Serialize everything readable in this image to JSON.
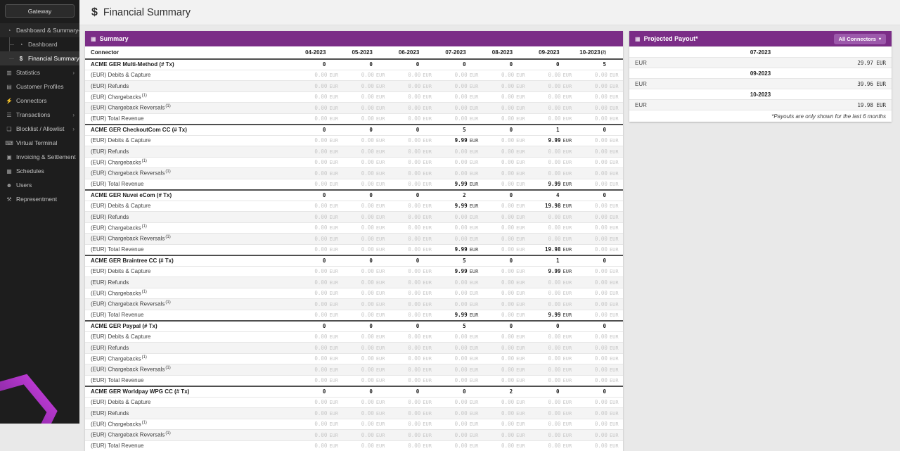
{
  "sidebar": {
    "gateway_label": "Gateway",
    "items": [
      {
        "label": "Dashboard & Summary",
        "icon": "dashboard-icon",
        "chevron": "down",
        "type": "parent"
      },
      {
        "label": "Dashboard",
        "icon": "dashboard-icon",
        "type": "child"
      },
      {
        "label": "Financial Summary",
        "icon": "dollar-icon",
        "type": "child",
        "active": true
      },
      {
        "label": "Statistics",
        "icon": "chart-icon",
        "chevron": "right"
      },
      {
        "label": "Customer Profiles",
        "icon": "profile-icon"
      },
      {
        "label": "Connectors",
        "icon": "plug-icon"
      },
      {
        "label": "Transactions",
        "icon": "list-icon",
        "chevron": "right"
      },
      {
        "label": "Blocklist / Allowlist",
        "icon": "file-icon",
        "chevron": "right"
      },
      {
        "label": "Virtual Terminal",
        "icon": "keyboard-icon"
      },
      {
        "label": "Invoicing & Settlement",
        "icon": "briefcase-icon"
      },
      {
        "label": "Schedules",
        "icon": "calendar-icon"
      },
      {
        "label": "Users",
        "icon": "users-icon"
      },
      {
        "label": "Representment",
        "icon": "wrench-icon"
      }
    ]
  },
  "header": {
    "title": "Financial Summary",
    "icon": "dollar-icon"
  },
  "summary_table": {
    "title": "Summary",
    "icon": "table-icon",
    "first_column_header": "Connector",
    "currency": "EUR",
    "months": [
      {
        "label": "04-2023"
      },
      {
        "label": "05-2023"
      },
      {
        "label": "06-2023"
      },
      {
        "label": "07-2023"
      },
      {
        "label": "08-2023"
      },
      {
        "label": "09-2023"
      },
      {
        "label": "10-2023",
        "sup": "(2)"
      }
    ],
    "groups": [
      {
        "name": "ACME GER Multi-Method (# Tx)",
        "counts": [
          "0",
          "0",
          "0",
          "0",
          "0",
          "0",
          "5"
        ],
        "rows": [
          {
            "label": "(EUR) Debits & Capture",
            "values": [
              "0.00",
              "0.00",
              "0.00",
              "0.00",
              "0.00",
              "0.00",
              "0.00"
            ]
          },
          {
            "label": "(EUR) Refunds",
            "values": [
              "0.00",
              "0.00",
              "0.00",
              "0.00",
              "0.00",
              "0.00",
              "0.00"
            ]
          },
          {
            "label": "(EUR) Chargebacks",
            "sup": "(1)",
            "values": [
              "0.00",
              "0.00",
              "0.00",
              "0.00",
              "0.00",
              "0.00",
              "0.00"
            ]
          },
          {
            "label": "(EUR) Chargeback Reversals",
            "sup": "(1)",
            "values": [
              "0.00",
              "0.00",
              "0.00",
              "0.00",
              "0.00",
              "0.00",
              "0.00"
            ]
          },
          {
            "label": "(EUR) Total Revenue",
            "values": [
              "0.00",
              "0.00",
              "0.00",
              "0.00",
              "0.00",
              "0.00",
              "0.00"
            ]
          }
        ]
      },
      {
        "name": "ACME GER CheckoutCom CC (# Tx)",
        "counts": [
          "0",
          "0",
          "0",
          "5",
          "0",
          "1",
          "0"
        ],
        "rows": [
          {
            "label": "(EUR) Debits & Capture",
            "values": [
              "0.00",
              "0.00",
              "0.00",
              "9.99",
              "0.00",
              "9.99",
              "0.00"
            ]
          },
          {
            "label": "(EUR) Refunds",
            "values": [
              "0.00",
              "0.00",
              "0.00",
              "0.00",
              "0.00",
              "0.00",
              "0.00"
            ]
          },
          {
            "label": "(EUR) Chargebacks",
            "sup": "(1)",
            "values": [
              "0.00",
              "0.00",
              "0.00",
              "0.00",
              "0.00",
              "0.00",
              "0.00"
            ]
          },
          {
            "label": "(EUR) Chargeback Reversals",
            "sup": "(1)",
            "values": [
              "0.00",
              "0.00",
              "0.00",
              "0.00",
              "0.00",
              "0.00",
              "0.00"
            ]
          },
          {
            "label": "(EUR) Total Revenue",
            "values": [
              "0.00",
              "0.00",
              "0.00",
              "9.99",
              "0.00",
              "9.99",
              "0.00"
            ]
          }
        ]
      },
      {
        "name": "ACME GER Nuvei eCom (# Tx)",
        "counts": [
          "0",
          "0",
          "0",
          "2",
          "0",
          "4",
          "0"
        ],
        "rows": [
          {
            "label": "(EUR) Debits & Capture",
            "values": [
              "0.00",
              "0.00",
              "0.00",
              "9.99",
              "0.00",
              "19.98",
              "0.00"
            ]
          },
          {
            "label": "(EUR) Refunds",
            "values": [
              "0.00",
              "0.00",
              "0.00",
              "0.00",
              "0.00",
              "0.00",
              "0.00"
            ]
          },
          {
            "label": "(EUR) Chargebacks",
            "sup": "(1)",
            "values": [
              "0.00",
              "0.00",
              "0.00",
              "0.00",
              "0.00",
              "0.00",
              "0.00"
            ]
          },
          {
            "label": "(EUR) Chargeback Reversals",
            "sup": "(1)",
            "values": [
              "0.00",
              "0.00",
              "0.00",
              "0.00",
              "0.00",
              "0.00",
              "0.00"
            ]
          },
          {
            "label": "(EUR) Total Revenue",
            "values": [
              "0.00",
              "0.00",
              "0.00",
              "9.99",
              "0.00",
              "19.98",
              "0.00"
            ]
          }
        ]
      },
      {
        "name": "ACME GER Braintree CC (# Tx)",
        "counts": [
          "0",
          "0",
          "0",
          "5",
          "0",
          "1",
          "0"
        ],
        "rows": [
          {
            "label": "(EUR) Debits & Capture",
            "values": [
              "0.00",
              "0.00",
              "0.00",
              "9.99",
              "0.00",
              "9.99",
              "0.00"
            ]
          },
          {
            "label": "(EUR) Refunds",
            "values": [
              "0.00",
              "0.00",
              "0.00",
              "0.00",
              "0.00",
              "0.00",
              "0.00"
            ]
          },
          {
            "label": "(EUR) Chargebacks",
            "sup": "(1)",
            "values": [
              "0.00",
              "0.00",
              "0.00",
              "0.00",
              "0.00",
              "0.00",
              "0.00"
            ]
          },
          {
            "label": "(EUR) Chargeback Reversals",
            "sup": "(1)",
            "values": [
              "0.00",
              "0.00",
              "0.00",
              "0.00",
              "0.00",
              "0.00",
              "0.00"
            ]
          },
          {
            "label": "(EUR) Total Revenue",
            "values": [
              "0.00",
              "0.00",
              "0.00",
              "9.99",
              "0.00",
              "9.99",
              "0.00"
            ]
          }
        ]
      },
      {
        "name": "ACME GER Paypal (# Tx)",
        "counts": [
          "0",
          "0",
          "0",
          "5",
          "0",
          "0",
          "0"
        ],
        "rows": [
          {
            "label": "(EUR) Debits & Capture",
            "values": [
              "0.00",
              "0.00",
              "0.00",
              "0.00",
              "0.00",
              "0.00",
              "0.00"
            ]
          },
          {
            "label": "(EUR) Refunds",
            "values": [
              "0.00",
              "0.00",
              "0.00",
              "0.00",
              "0.00",
              "0.00",
              "0.00"
            ]
          },
          {
            "label": "(EUR) Chargebacks",
            "sup": "(1)",
            "values": [
              "0.00",
              "0.00",
              "0.00",
              "0.00",
              "0.00",
              "0.00",
              "0.00"
            ]
          },
          {
            "label": "(EUR) Chargeback Reversals",
            "sup": "(1)",
            "values": [
              "0.00",
              "0.00",
              "0.00",
              "0.00",
              "0.00",
              "0.00",
              "0.00"
            ]
          },
          {
            "label": "(EUR) Total Revenue",
            "values": [
              "0.00",
              "0.00",
              "0.00",
              "0.00",
              "0.00",
              "0.00",
              "0.00"
            ]
          }
        ]
      },
      {
        "name": "ACME GER Worldpay WPG CC (# Tx)",
        "counts": [
          "0",
          "0",
          "0",
          "0",
          "2",
          "0",
          "0"
        ],
        "rows": [
          {
            "label": "(EUR) Debits & Capture",
            "values": [
              "0.00",
              "0.00",
              "0.00",
              "0.00",
              "0.00",
              "0.00",
              "0.00"
            ]
          },
          {
            "label": "(EUR) Refunds",
            "values": [
              "0.00",
              "0.00",
              "0.00",
              "0.00",
              "0.00",
              "0.00",
              "0.00"
            ]
          },
          {
            "label": "(EUR) Chargebacks",
            "sup": "(1)",
            "values": [
              "0.00",
              "0.00",
              "0.00",
              "0.00",
              "0.00",
              "0.00",
              "0.00"
            ]
          },
          {
            "label": "(EUR) Chargeback Reversals",
            "sup": "(1)",
            "values": [
              "0.00",
              "0.00",
              "0.00",
              "0.00",
              "0.00",
              "0.00",
              "0.00"
            ]
          },
          {
            "label": "(EUR) Total Revenue",
            "values": [
              "0.00",
              "0.00",
              "0.00",
              "0.00",
              "0.00",
              "0.00",
              "0.00"
            ]
          }
        ]
      }
    ]
  },
  "projected_payout": {
    "title": "Projected Payout*",
    "icon": "table-icon",
    "filter_button": "All Connectors",
    "row_label": "EUR",
    "rows": [
      {
        "month": "07-2023",
        "value": "29.97 EUR"
      },
      {
        "month": "09-2023",
        "value": "39.96 EUR"
      },
      {
        "month": "10-2023",
        "value": "19.98 EUR"
      }
    ],
    "footnote": "*Payouts are only shown for the last 6 months"
  },
  "colors": {
    "accent_purple": "#7b2d87",
    "sidebar_bg": "#1d1d1d"
  }
}
